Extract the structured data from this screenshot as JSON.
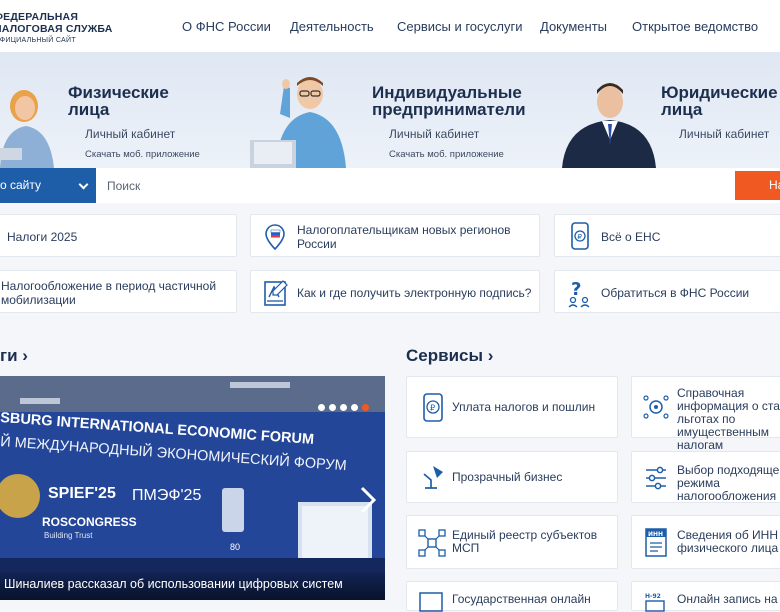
{
  "header": {
    "logo_line1": "ФЕДЕРАЛЬНАЯ",
    "logo_line2": "НАЛОГОВАЯ СЛУЖБА",
    "logo_line3": "ОФИЦИАЛЬНЫЙ САЙТ",
    "nav": [
      "О ФНС России",
      "Деятельность",
      "Сервисы и госуслуги",
      "Документы",
      "Открытое ведомство"
    ]
  },
  "hero": {
    "physical": {
      "title1": "Физические",
      "title2": "лица",
      "cabinet": "Личный кабинет",
      "app": "Скачать моб. приложение"
    },
    "ip": {
      "title1": "Индивидуальные",
      "title2": "предприниматели",
      "cabinet": "Личный кабинет",
      "app": "Скачать моб. приложение"
    },
    "legal": {
      "title1": "Юридические",
      "title2": "лица",
      "cabinet": "Личный кабинет"
    }
  },
  "search": {
    "scope": "о сайту",
    "placeholder": "Поиск",
    "button": "На"
  },
  "quick": [
    {
      "label": "Налоги 2025",
      "icon": "calendar-icon"
    },
    {
      "label": "Налогоплательщикам новых регионов России",
      "icon": "map-pin-flag-icon"
    },
    {
      "label": "Всё о ЕНС",
      "icon": "phone-ruble-icon"
    },
    {
      "label": "Налогообложение в период частичной мобилизации",
      "icon": ""
    },
    {
      "label": "Как и где получить электронную подпись?",
      "icon": "signature-icon"
    },
    {
      "label": "Обратиться в ФНС России",
      "icon": "question-people-icon"
    }
  ],
  "sections": {
    "news": "ги",
    "services": "Сервисы"
  },
  "news": {
    "caption": "Шиналиев рассказал об использовании цифровых систем",
    "banner_en": "SBURG INTERNATIONAL ECONOMIC FORUM",
    "banner_ru": "Й МЕЖДУНАРОДНЫЙ ЭКОНОМИЧЕСКИЙ ФОРУМ",
    "spief": "SPIEF'25",
    "pmef": "ПМЭФ'25",
    "roscongress": "ROSCONGRESS",
    "building_trust": "Building Trust",
    "slides": 5,
    "active_slide": 5
  },
  "services": [
    {
      "label": "Уплата налогов и пошлин",
      "icon": "ruble-doc-icon"
    },
    {
      "label": "Справочная информация о ставках и льготах по имущественным налогам",
      "icon": "gear-network-icon"
    },
    {
      "label": "Прозрачный бизнес",
      "icon": "lamp-icon"
    },
    {
      "label": "Выбор подходящего режима налогообложения",
      "icon": "sliders-icon"
    },
    {
      "label": "Единый реестр субъектов МСП",
      "icon": "network-icon"
    },
    {
      "label": "Сведения об ИНН физического лица",
      "icon": "inn-icon"
    },
    {
      "label": "Государственная онлайн",
      "icon": "msp-icon"
    },
    {
      "label": "Онлайн запись на",
      "icon": "form-icon"
    }
  ],
  "colors": {
    "brand": "#1e5ea8",
    "accent": "#f05a22",
    "text": "#1c2f4f"
  }
}
